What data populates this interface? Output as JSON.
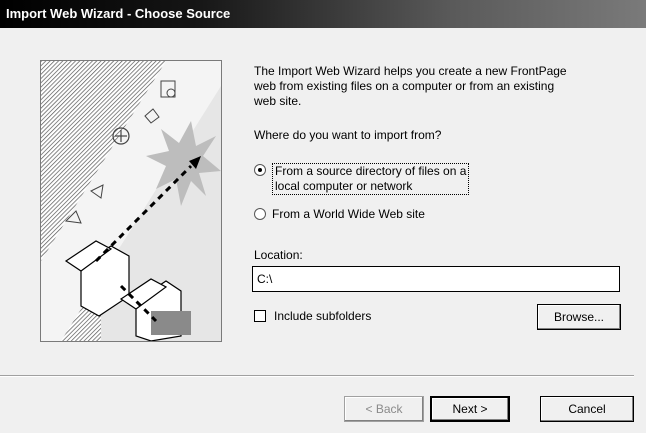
{
  "window": {
    "title": "Import Web Wizard - Choose Source"
  },
  "intro": "The Import Web Wizard helps you create a new FrontPage\nweb from existing files on a computer or from an existing\nweb site.",
  "question": "Where do you want to import from?",
  "options": [
    {
      "label": "From a source directory of files on a\nlocal computer or network",
      "selected": true
    },
    {
      "label": "From a World Wide Web site",
      "selected": false
    }
  ],
  "location": {
    "label": "Location:",
    "value": "C:\\"
  },
  "include_subfolders": {
    "label": "Include subfolders",
    "checked": false
  },
  "buttons": {
    "browse": "Browse...",
    "back": "< Back",
    "next": "Next >",
    "cancel": "Cancel"
  }
}
